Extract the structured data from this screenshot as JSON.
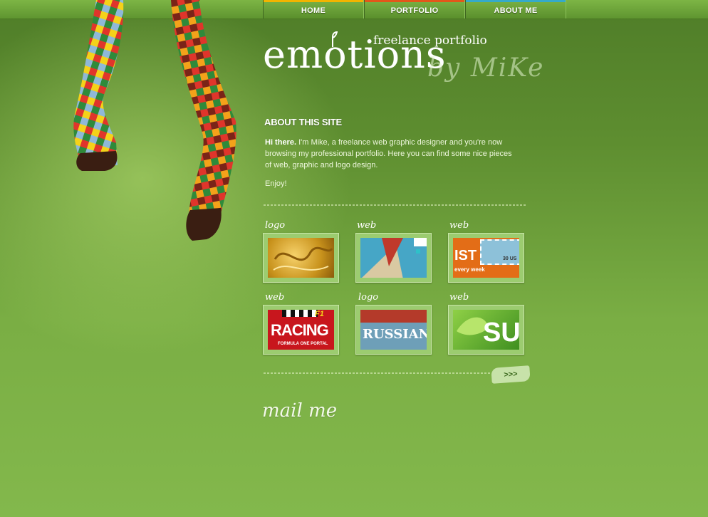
{
  "nav": [
    {
      "label": "HOME",
      "color": "#f2b400"
    },
    {
      "label": "PORTFOLIO",
      "color": "#e2571a"
    },
    {
      "label": "ABOUT ME",
      "color": "#35aac9"
    }
  ],
  "logo": {
    "word": "emotions",
    "subtitle": "freelance portfolio",
    "signature": "by MiKe"
  },
  "about": {
    "title": "ABOUT THIS SITE",
    "greeting": "Hi there.",
    "text": " I'm Mike, a freelance web graphic designer and you're now browsing my professional portfolio. Here you can find some nice pieces of web, graphic and logo design.",
    "enjoy": "Enjoy!"
  },
  "portfolio": [
    {
      "category": "logo",
      "thumb": "gold-emblem"
    },
    {
      "category": "web",
      "thumb": "paper-planes"
    },
    {
      "category": "web",
      "thumb": "stamp",
      "caption": "IST",
      "subcaption": "every week",
      "value": "30 US"
    },
    {
      "category": "web",
      "thumb": "racing",
      "caption": "RACING",
      "subcaption": "FORMULA ONE PORTAL",
      "badge": "F1"
    },
    {
      "category": "logo",
      "thumb": "russian",
      "caption": "RUSSIAN"
    },
    {
      "category": "web",
      "thumb": "leaf",
      "caption": "SU"
    }
  ],
  "more_label": ">>>",
  "mail_label": "mail me"
}
